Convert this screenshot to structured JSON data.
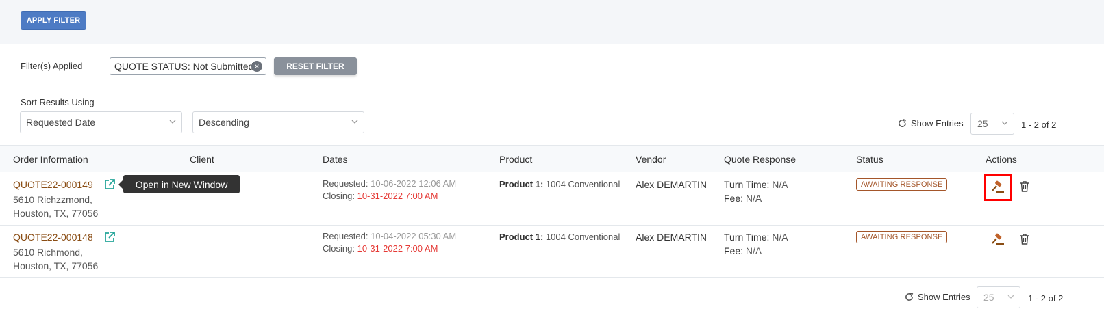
{
  "filter": {
    "apply_label": "APPLY FILTER",
    "applied_label": "Filter(s) Applied",
    "chip_text": "QUOTE STATUS: Not Submitted",
    "reset_label": "RESET FILTER"
  },
  "sort": {
    "label": "Sort Results Using",
    "field": "Requested Date",
    "order": "Descending"
  },
  "pagination": {
    "show_entries": "Show Entries",
    "per_page": "25",
    "range": "1 - 2 of 2"
  },
  "table": {
    "headers": [
      "Order Information",
      "Client",
      "Dates",
      "Product",
      "Vendor",
      "Quote Response",
      "Status",
      "Actions"
    ],
    "rows": [
      {
        "order_id": "QUOTE22-000149",
        "address1": "5610 Richzzmond,",
        "address2": "Houston, TX, 77056",
        "requested_label": "Requested:",
        "requested": "10-06-2022 12:06 AM",
        "closing_label": "Closing:",
        "closing": "10-31-2022 7:00 AM",
        "product_label": "Product 1:",
        "product": "1004 Conventional",
        "vendor": "Alex DEMARTIN",
        "turn_label": "Turn Time:",
        "turn": "N/A",
        "fee_label": "Fee:",
        "fee": "N/A",
        "status": "AWAITING RESPONSE"
      },
      {
        "order_id": "QUOTE22-000148",
        "address1": "5610 Richmond,",
        "address2": "Houston, TX, 77056",
        "requested_label": "Requested:",
        "requested": "10-04-2022 05:30 AM",
        "closing_label": "Closing:",
        "closing": "10-31-2022 7:00 AM",
        "product_label": "Product 1:",
        "product": "1004 Conventional",
        "vendor": "Alex DEMARTIN",
        "turn_label": "Turn Time:",
        "turn": "N/A",
        "fee_label": "Fee:",
        "fee": "N/A",
        "status": "AWAITING RESPONSE"
      }
    ]
  },
  "tooltip": "Open in New Window",
  "colors": {
    "accent": "#4d7bc4",
    "order_link": "#8a4d14",
    "closing_date": "#e53935",
    "status_badge": "#a4562a",
    "external_link_icon": "#26a69a",
    "highlight": "#ff0000"
  },
  "icons": [
    "external-link-icon",
    "gavel-icon",
    "trash-icon",
    "refresh-icon",
    "chevron-down-icon",
    "close-circle-icon"
  ]
}
